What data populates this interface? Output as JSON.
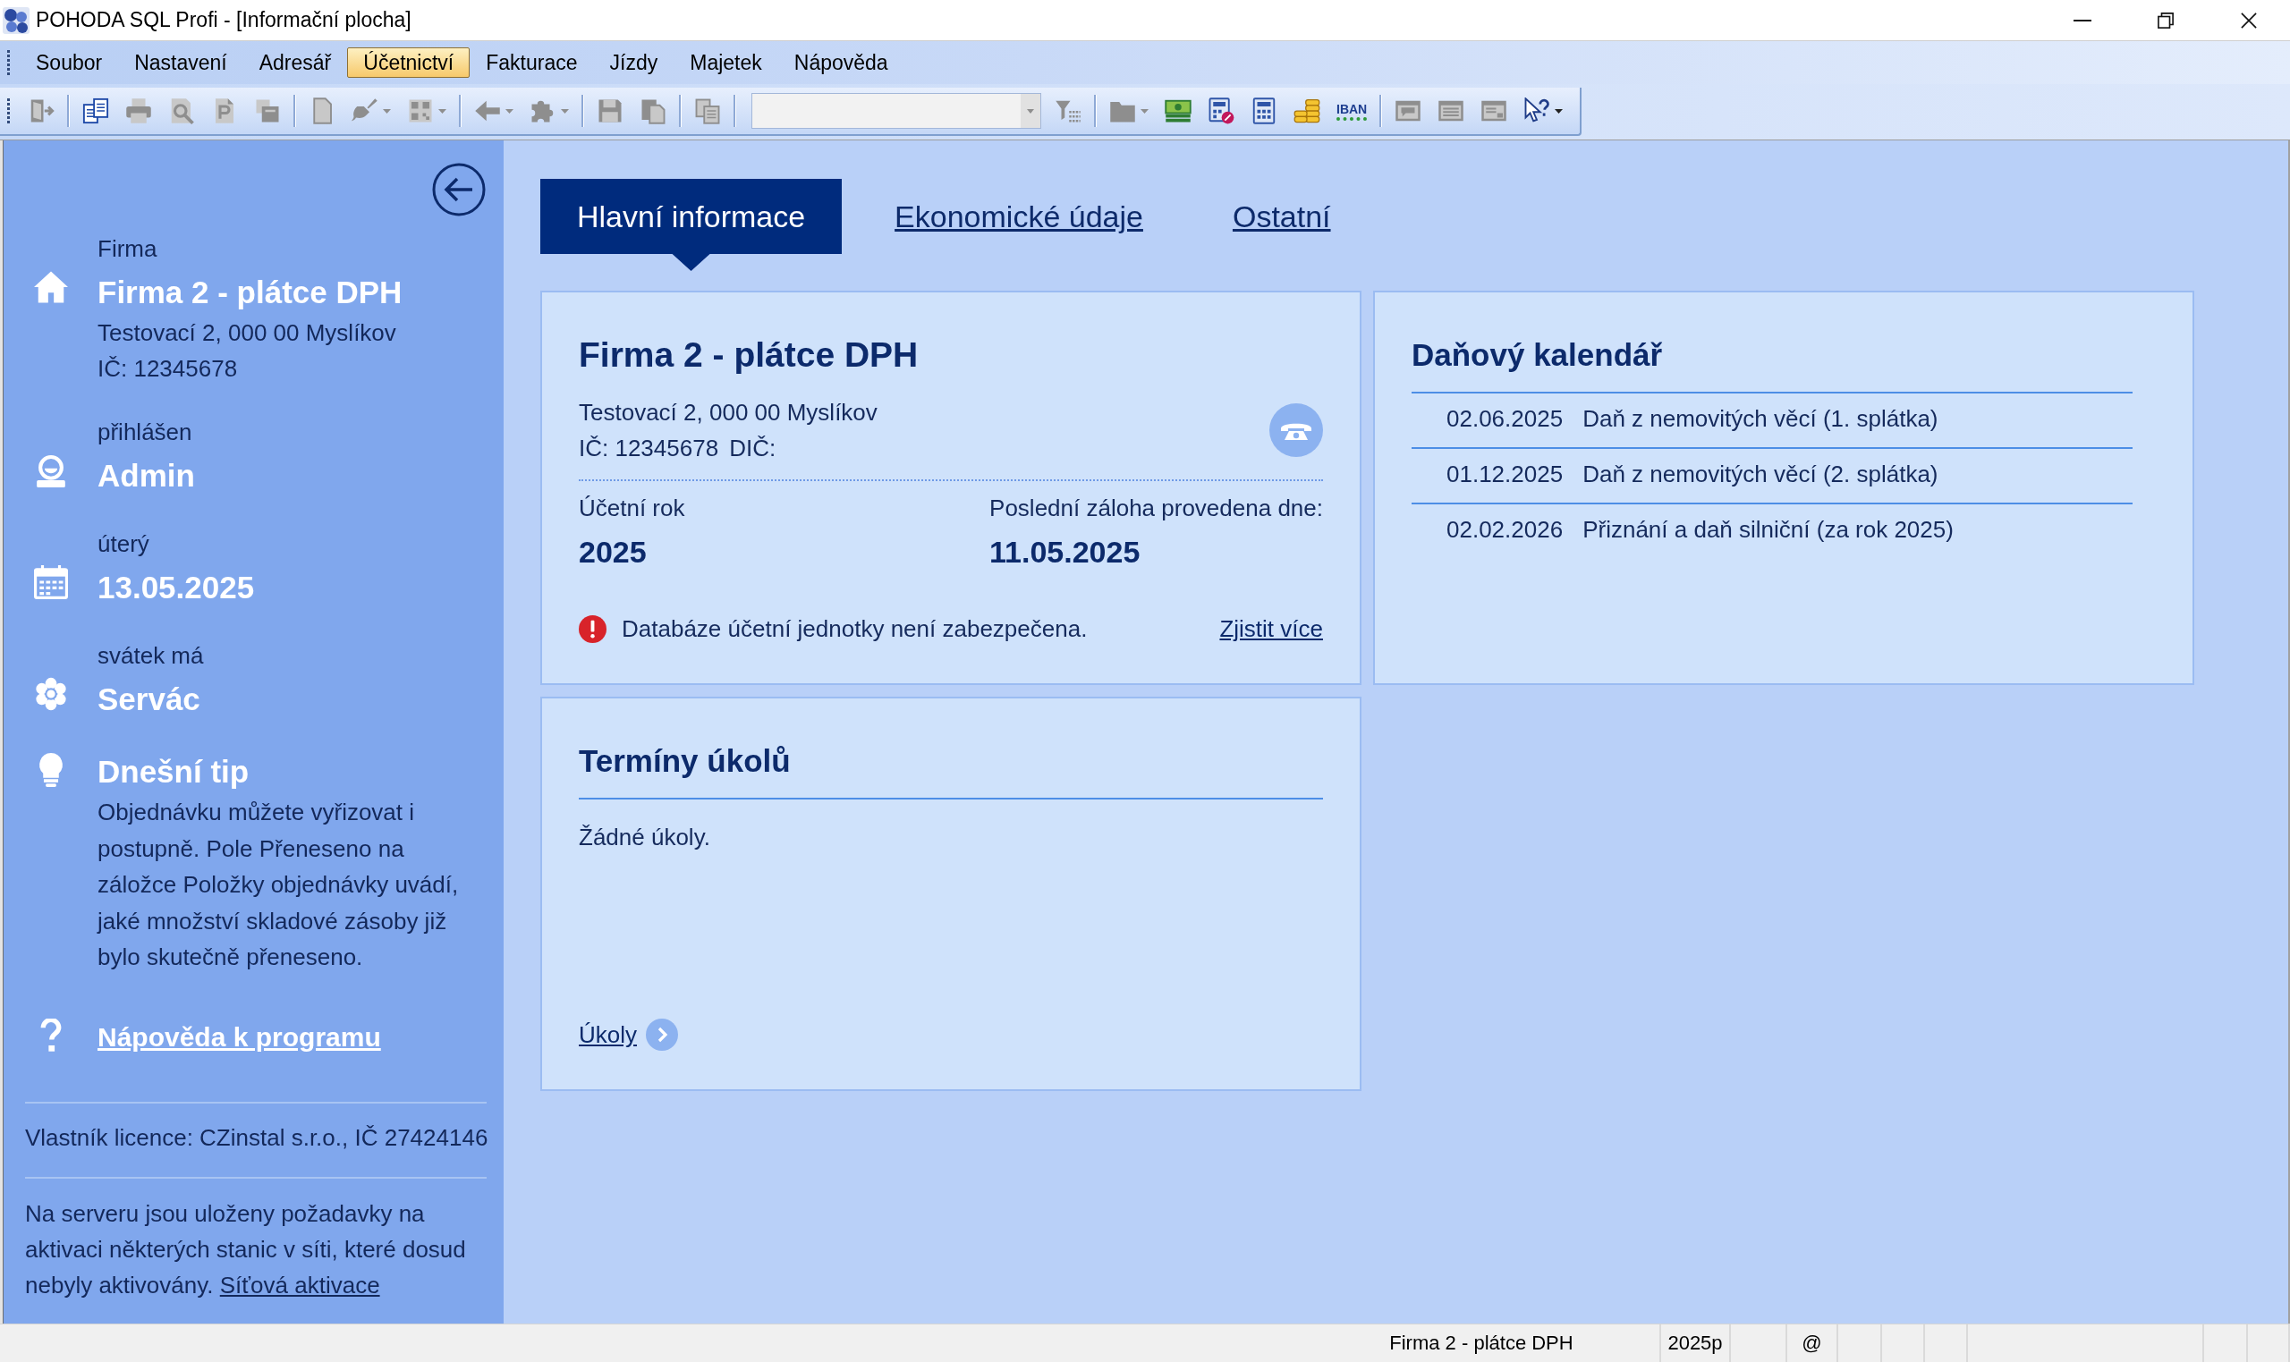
{
  "window": {
    "title": "POHODA SQL Profi - [Informační plocha]"
  },
  "menu": [
    {
      "label": "Soubor",
      "selected": false
    },
    {
      "label": "Nastavení",
      "selected": false
    },
    {
      "label": "Adresář",
      "selected": false
    },
    {
      "label": "Účetnictví",
      "selected": true
    },
    {
      "label": "Fakturace",
      "selected": false
    },
    {
      "label": "Jízdy",
      "selected": false
    },
    {
      "label": "Majetek",
      "selected": false
    },
    {
      "label": "Nápověda",
      "selected": false
    }
  ],
  "toolbar": {
    "items": [
      {
        "kind": "button",
        "disabled": true,
        "dropdown": false
      },
      {
        "kind": "separator"
      },
      {
        "kind": "button",
        "disabled": false,
        "dropdown": false
      },
      {
        "kind": "button",
        "disabled": true,
        "dropdown": false
      },
      {
        "kind": "button",
        "disabled": true,
        "dropdown": false
      },
      {
        "kind": "button",
        "disabled": true,
        "dropdown": false
      },
      {
        "kind": "button",
        "disabled": true,
        "dropdown": false
      },
      {
        "kind": "separator"
      },
      {
        "kind": "button",
        "disabled": true,
        "dropdown": false
      },
      {
        "kind": "button",
        "disabled": true,
        "dropdown": true
      },
      {
        "kind": "button",
        "disabled": true,
        "dropdown": true
      },
      {
        "kind": "separator"
      },
      {
        "kind": "button",
        "disabled": true,
        "dropdown": true
      },
      {
        "kind": "button",
        "disabled": true,
        "dropdown": true
      },
      {
        "kind": "separator"
      },
      {
        "kind": "button",
        "disabled": true,
        "dropdown": false
      },
      {
        "kind": "button",
        "disabled": true,
        "dropdown": false
      },
      {
        "kind": "separator"
      },
      {
        "kind": "button",
        "disabled": true,
        "dropdown": false
      },
      {
        "kind": "separator"
      },
      {
        "kind": "combo",
        "disabled": true
      },
      {
        "kind": "button",
        "disabled": true,
        "dropdown": false
      },
      {
        "kind": "separator"
      },
      {
        "kind": "button",
        "disabled": true,
        "dropdown": true
      },
      {
        "kind": "button",
        "disabled": false,
        "dropdown": false
      },
      {
        "kind": "button",
        "disabled": false,
        "dropdown": false
      },
      {
        "kind": "button",
        "disabled": false,
        "dropdown": false
      },
      {
        "kind": "button",
        "disabled": false,
        "dropdown": false
      },
      {
        "kind": "button",
        "disabled": false,
        "dropdown": false,
        "label": "IBAN"
      },
      {
        "kind": "separator"
      },
      {
        "kind": "button",
        "disabled": true,
        "dropdown": false
      },
      {
        "kind": "button",
        "disabled": true,
        "dropdown": false
      },
      {
        "kind": "button",
        "disabled": true,
        "dropdown": false
      },
      {
        "kind": "button",
        "disabled": false,
        "dropdown": true
      }
    ]
  },
  "sidebar": {
    "items": [
      {
        "label": "Firma",
        "value": "Firma 2 - plátce DPH",
        "details": [
          "Testovací 2, 000 00 Myslíkov",
          "IČ: 12345678"
        ]
      },
      {
        "label": "přihlášen",
        "value": "Admin"
      },
      {
        "label": "úterý",
        "value": "13.05.2025"
      },
      {
        "label": "svátek má",
        "value": "Servác"
      },
      {
        "value": "Dnešní tip",
        "text": "Objednávku můžete vyřizovat i postupně. Pole Přeneseno na záložce Položky objednávky uvádí, jaké množství skladové zásoby již bylo skutečně přeneseno."
      },
      {
        "link": "Nápověda k programu"
      }
    ],
    "license": "Vlastník licence: CZinstal s.r.o., IČ 27424146",
    "notice": {
      "text": "Na serveru jsou uloženy požadavky na aktivaci některých stanic v síti, které dosud nebyly aktivovány.",
      "link": "Síťová aktivace"
    }
  },
  "tabs": [
    {
      "label": "Hlavní informace",
      "selected": true
    },
    {
      "label": "Ekonomické údaje",
      "selected": false
    },
    {
      "label": "Ostatní",
      "selected": false
    }
  ],
  "company_card": {
    "title": "Firma 2 - plátce DPH",
    "address": "Testovací 2, 000 00 Myslíkov",
    "company_id": "IČ: 12345678",
    "vat_id": "DIČ:",
    "fiscal_year": {
      "label": "Účetní rok",
      "value": "2025"
    },
    "last_backup": {
      "label": "Poslední záloha provedena dne:",
      "value": "11.05.2025"
    },
    "warning": {
      "text": "Databáze účetní jednotky není zabezpečena.",
      "link": "Zjistit více"
    }
  },
  "tax_calendar": {
    "title": "Daňový kalendář",
    "rows": [
      {
        "date": "02.06.2025",
        "name": "Daň z nemovitých věcí (1. splátka)"
      },
      {
        "date": "01.12.2025",
        "name": "Daň z nemovitých věcí (2. splátka)"
      },
      {
        "date": "02.02.2026",
        "name": "Přiznání a daň silniční (za rok 2025)"
      }
    ]
  },
  "tasks": {
    "title": "Termíny úkolů",
    "empty": "Žádné úkoly.",
    "link": "Úkoly"
  },
  "status_bar": {
    "cells": [
      "Firma 2 - plátce DPH",
      "2025p",
      "@"
    ]
  }
}
